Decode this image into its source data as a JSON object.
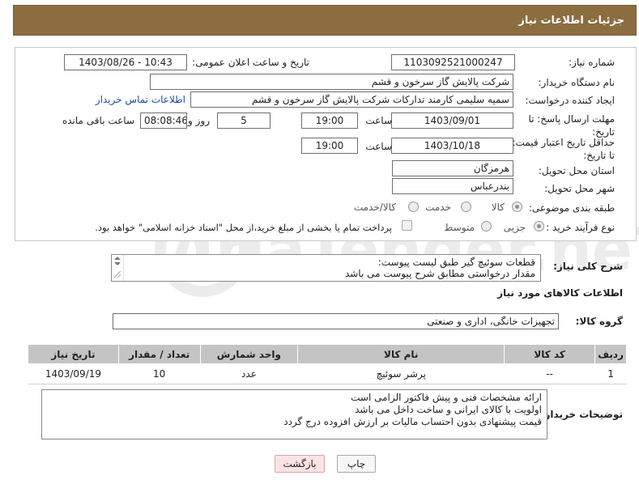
{
  "page": {
    "title": "جزئیات اطلاعات نیاز"
  },
  "form": {
    "need_number_label": "شماره نیاز:",
    "need_number": "1103092521000247",
    "announce_label": "تاریخ و ساعت اعلان عمومی:",
    "announce_value": "1403/08/26 - 10:43",
    "buyer_org_label": "نام دستگاه خریدار:",
    "buyer_org": "شرکت پالایش گاز سرخون و قشم",
    "creator_label": "ایجاد کننده درخواست:",
    "creator": "سمیه سلیمی کارمند تدارکات شرکت پالایش گاز سرخون و قشم",
    "buyer_contact_link": "اطلاعات تماس خریدار",
    "deadline_label": "مهلت ارسال پاسخ: تا تاریخ:",
    "deadline_date": "1403/09/01",
    "time_label": "ساعت",
    "deadline_time": "19:00",
    "days_value": "5",
    "days_label": "روز و",
    "remaining_time": "08:08:46",
    "remaining_label": "ساعت باقی مانده",
    "min_validity_label": "حداقل تاریخ اعتبار قیمت: تا تاریخ:",
    "validity_date": "1403/10/18",
    "validity_time": "19:00",
    "province_label": "استان محل تحویل:",
    "province": "هرمزگان",
    "city_label": "شهر محل تحویل:",
    "city": "بندرعباس",
    "category_label": "طبقه بندی موضوعی:",
    "category_options": [
      "کالا",
      "خدمت",
      "کالا/خدمت"
    ],
    "process_label": "نوع فرآیند خرید :",
    "process_options": [
      "جزیی",
      "متوسط"
    ],
    "payment_note": "پرداخت تمام یا بخشی از مبلغ خرید،از محل \"اسناد خزانه اسلامی\" خواهد بود."
  },
  "description": {
    "label": "شرح کلی نیاز:",
    "lines": [
      "قطعات سوئیچ گیر طبق لیست پیوست:",
      "مقدار درخواستی مطابق شرح پیوست می باشد"
    ]
  },
  "goods": {
    "section_title": "اطلاعات کالاهای مورد نیاز",
    "group_label": "گروه کالا:",
    "group_value": "تجهیزات خانگی، اداری و صنعتی",
    "columns": [
      "ردیف",
      "کد کالا",
      "نام کالا",
      "واحد شمارش",
      "تعداد / مقدار",
      "تاریخ نیاز"
    ],
    "rows": [
      {
        "index": "1",
        "code": "--",
        "name": "پرشر سوئیچ",
        "unit": "عدد",
        "qty": "10",
        "date": "1403/09/19"
      }
    ]
  },
  "buyer_notes": {
    "label": "توضیحات خریدار:",
    "lines": [
      "ارائه مشخصات فنی و پیش فاکتور الزامی است",
      "اولویت با کالای ایرانی و ساخت داخل می باشد",
      "قیمت پیشنهادی بدون احتساب مالیات بر ارزش افزوده درج گردد"
    ]
  },
  "actions": {
    "print_label": "چاپ",
    "back_label": "بازگشت"
  },
  "watermark": {
    "brand": "AriaTender.neT"
  },
  "colors": {
    "header_bg": "#8b6d40",
    "table_header_bg": "#c4c4c4",
    "link": "#1f4aa8",
    "back_button_bg": "#fbe3e3"
  }
}
